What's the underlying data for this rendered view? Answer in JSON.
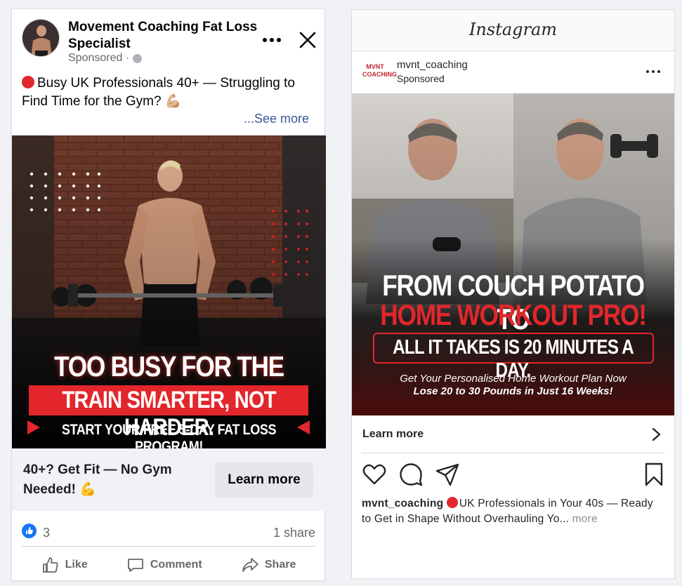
{
  "facebook": {
    "page_name": "Movement Coaching Fat Loss Specialist",
    "sponsored": "Sponsored ·",
    "post_text": "Busy UK Professionals 40+ — Struggling to Find Time for the Gym? 💪🏼",
    "see_more": "...See more",
    "image_text": {
      "headline": "TOO BUSY FOR THE GYM?",
      "subheadline": "TRAIN SMARTER, NOT HARDER.",
      "cta_line": "START YOUR FREE 5-DAY FAT LOSS PROGRAM!"
    },
    "cta_text": "40+? Get Fit — No Gym Needed! 💪",
    "cta_button": "Learn more",
    "like_count": "3",
    "share_count": "1 share",
    "actions": {
      "like": "Like",
      "comment": "Comment",
      "share": "Share"
    }
  },
  "instagram": {
    "logo": "Instagram",
    "avatar_text": "MVNT COACHING",
    "username": "mvnt_coaching",
    "sponsored": "Sponsored",
    "image_text": {
      "line1": "FROM COUCH POTATO TO",
      "line2": "HOME WORKOUT PRO!",
      "line3": "ALL IT TAKES IS 20 MINUTES A DAY.",
      "sub1": "Get Your Personalised Home Workout Plan Now",
      "sub2": "Lose 20 to 30 Pounds in Just 16 Weeks!"
    },
    "learn_more": "Learn more",
    "caption_user": "mvnt_coaching",
    "caption_text": "UK Professionals in Your 40s — Ready to Get in Shape Without Overhauling Yo...",
    "caption_more": "more"
  },
  "colors": {
    "brand_red": "#e3262b",
    "fb_blue": "#1877f2",
    "link": "#385898"
  }
}
